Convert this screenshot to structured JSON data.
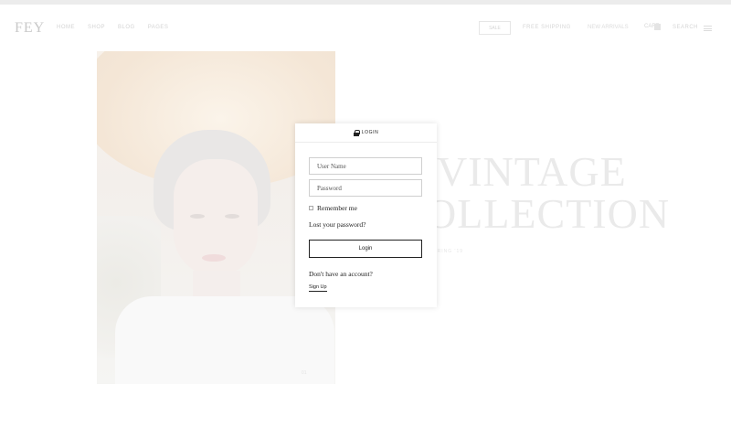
{
  "header": {
    "logo": "FEY",
    "nav": [
      "HOME",
      "SHOP",
      "BLOG",
      "PAGES"
    ],
    "button_label": "SALE",
    "right_link_1": "FREE SHIPPING",
    "right_link_2": "NEW ARRIVALS",
    "cart_label": "CART",
    "search_label": "SEARCH"
  },
  "hero": {
    "title_line1": "VINTAGE",
    "title_line2": "OLLECTION",
    "subtitle": "SPRING '19",
    "slide_number": "01"
  },
  "login_modal": {
    "title": "LOGIN",
    "username_placeholder": "User Name",
    "password_placeholder": "Password",
    "remember_label": "Remember me",
    "lost_password": "Lost your password?",
    "login_button": "Login",
    "no_account": "Don't have an account?",
    "signup_link": "Sign Up"
  },
  "colors": {
    "text": "#222222",
    "field_border": "#cfcfcf",
    "faded": "#eaeaea"
  }
}
